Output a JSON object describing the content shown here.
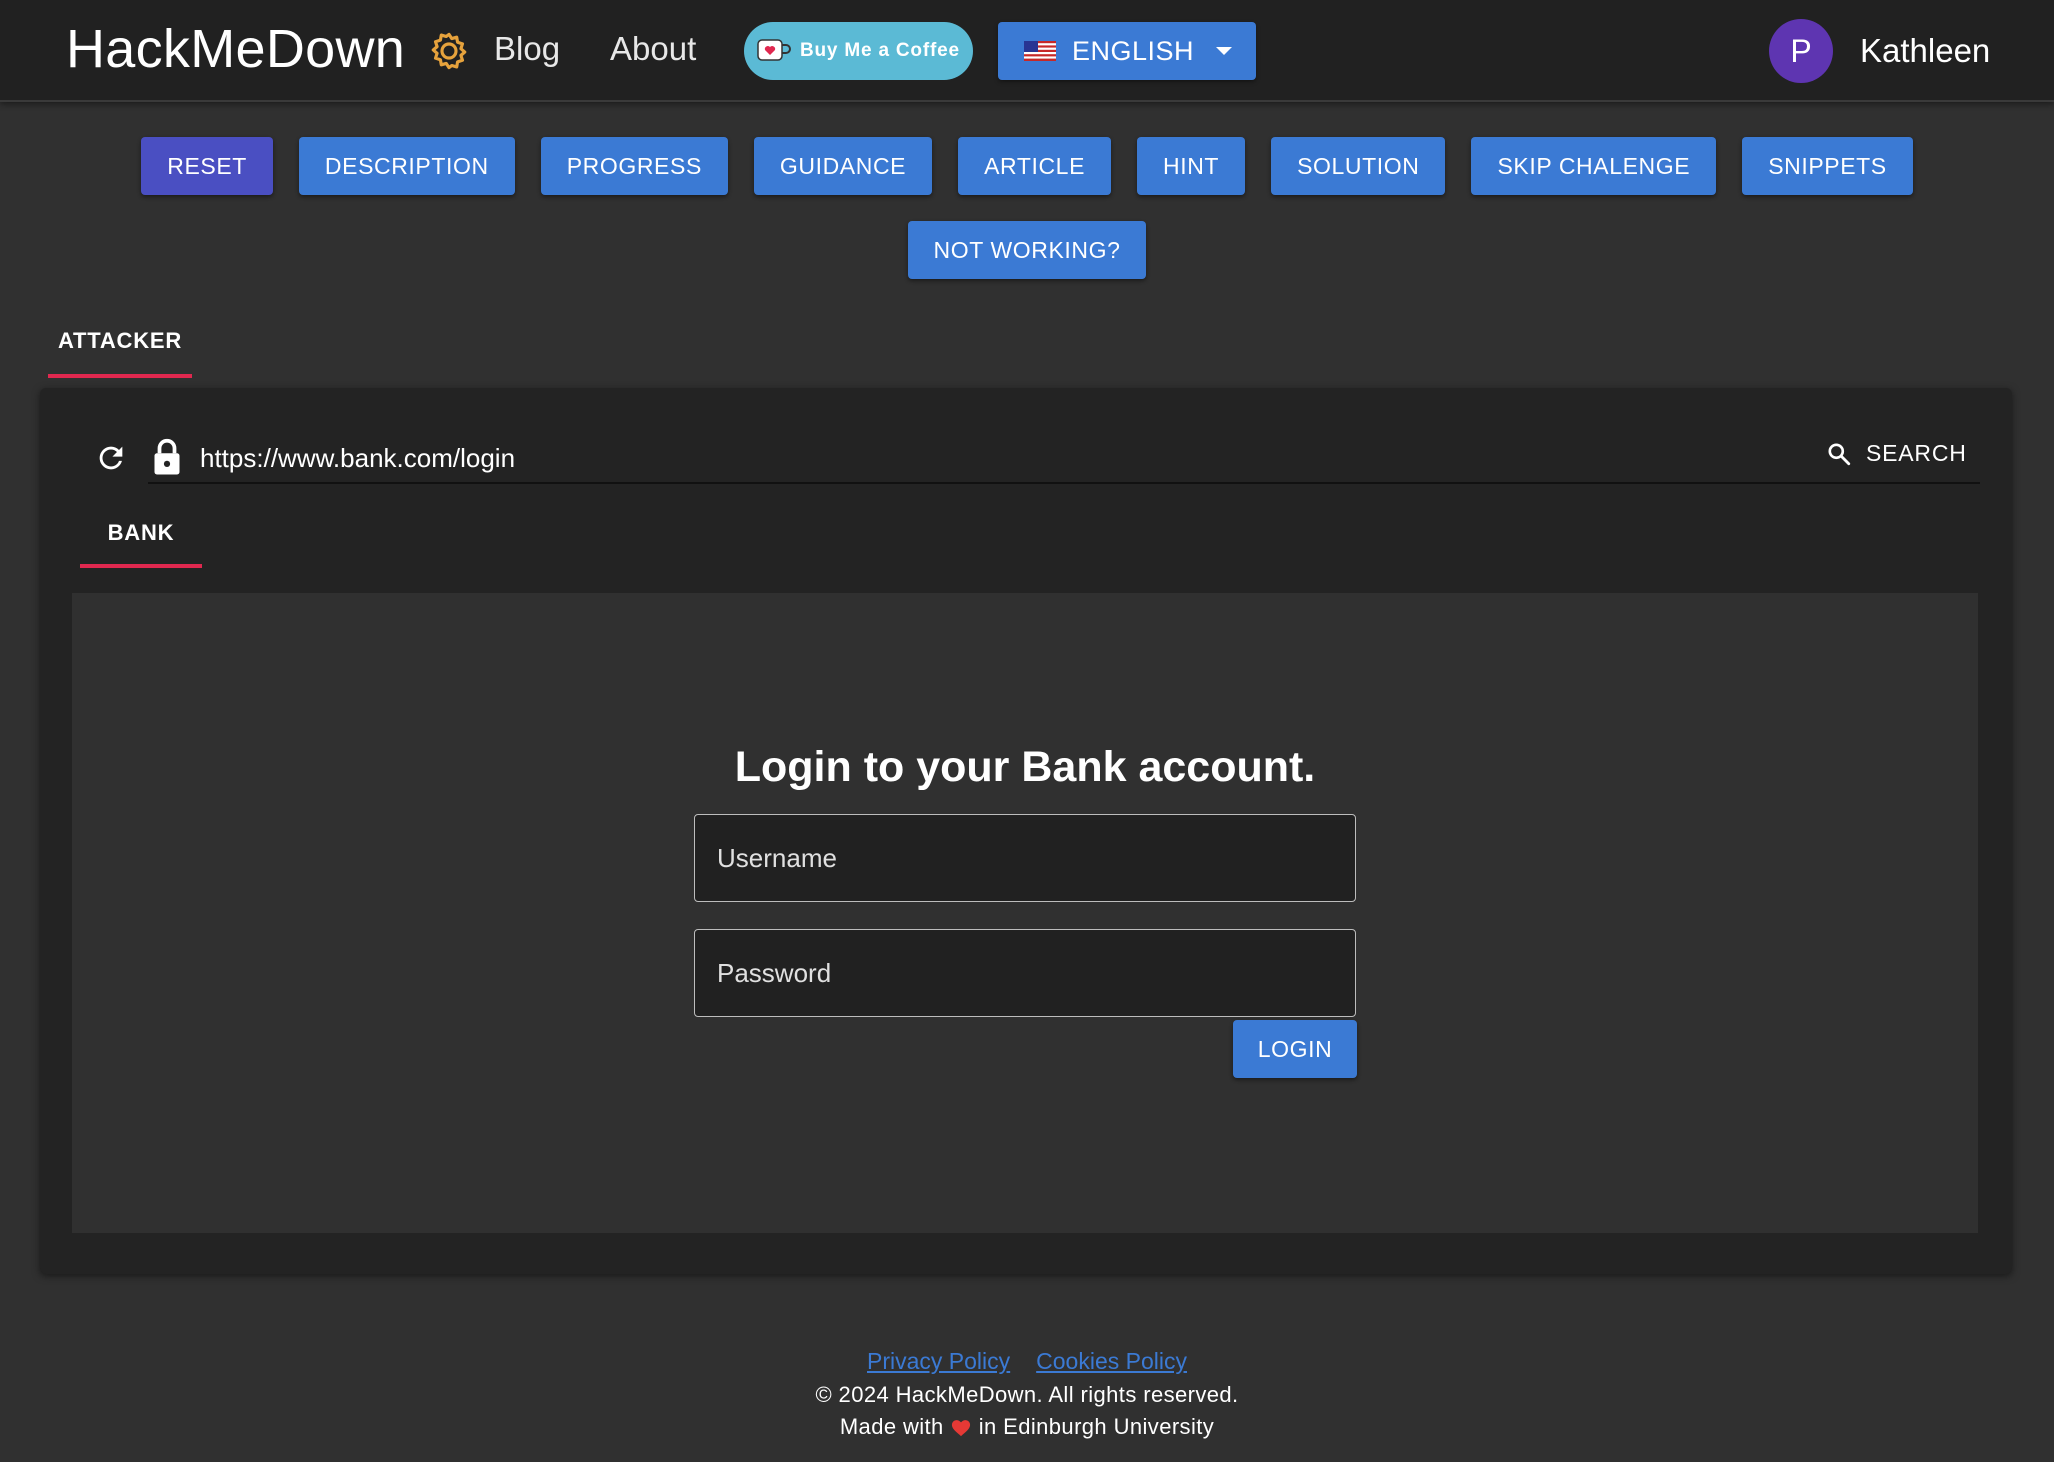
{
  "header": {
    "brand": "HackMeDown",
    "nav": {
      "blog": "Blog",
      "about": "About"
    },
    "coffee_label": "Buy Me a Coffee",
    "language": {
      "selected": "ENGLISH",
      "flag_icon": "us-flag-icon"
    },
    "user": {
      "avatar_initial": "P",
      "name": "Kathleen"
    }
  },
  "actions": {
    "row1": [
      "RESET",
      "DESCRIPTION",
      "PROGRESS",
      "GUIDANCE",
      "ARTICLE",
      "HINT",
      "SOLUTION",
      "SKIP CHALENGE",
      "SNIPPETS"
    ],
    "row2": [
      "NOT WORKING?"
    ]
  },
  "tabs": {
    "attacker": "ATTACKER"
  },
  "browser": {
    "url": "https://www.bank.com/login",
    "search_label": "SEARCH",
    "tab": "BANK",
    "page": {
      "title": "Login to your Bank account.",
      "username_placeholder": "Username",
      "password_placeholder": "Password",
      "login_label": "LOGIN"
    }
  },
  "footer": {
    "privacy": "Privacy Policy",
    "cookies": "Cookies Policy",
    "copyright": "© 2024 HackMeDown. All rights reserved.",
    "made_with_prefix": "Made with",
    "made_with_suffix": "in Edinburgh University"
  },
  "colors": {
    "topbar": "#212121",
    "background": "#303030",
    "button_blue": "#3b7ad4",
    "reset_button": "#4a4fc2",
    "tab_indicator": "#e0284f",
    "avatar": "#5e35b1",
    "coffee": "#5bbad5",
    "gear": "#e6a23c"
  }
}
